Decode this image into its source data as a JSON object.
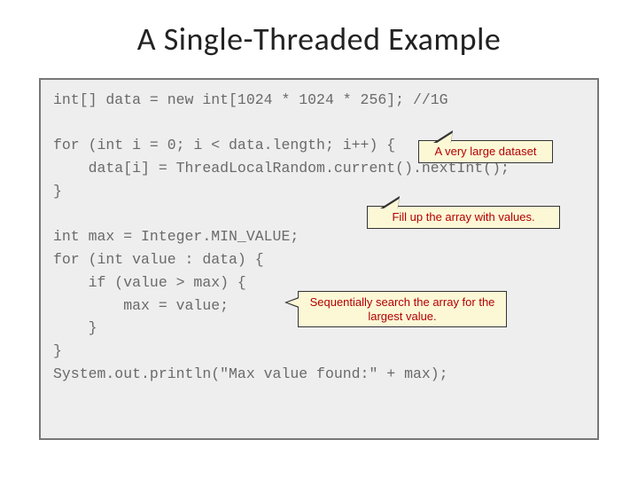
{
  "title": "A Single-Threaded Example",
  "code": "int[] data = new int[1024 * 1024 * 256]; //1G\n\nfor (int i = 0; i < data.length; i++) {\n    data[i] = ThreadLocalRandom.current().nextInt();\n}\n\nint max = Integer.MIN_VALUE;\nfor (int value : data) {\n    if (value > max) {\n        max = value;\n    }\n}\nSystem.out.println(\"Max value found:\" + max);",
  "callouts": {
    "dataset": "A very large dataset",
    "fill": "Fill up the array with values.",
    "search": "Sequentially search the array for the largest value."
  }
}
